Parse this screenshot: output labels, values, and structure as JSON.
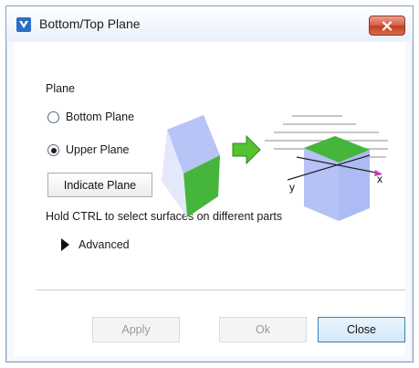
{
  "window": {
    "title": "Bottom/Top Plane"
  },
  "plane": {
    "heading": "Plane",
    "options": [
      {
        "label": "Bottom Plane",
        "selected": false
      },
      {
        "label": "Upper Plane",
        "selected": true
      }
    ],
    "indicate_label": "Indicate Plane",
    "hint": "Hold CTRL to select surfaces on different parts",
    "advanced_label": "Advanced"
  },
  "illustration": {
    "axis_y": "y",
    "axis_x": "x"
  },
  "footer": {
    "apply_label": "Apply",
    "ok_label": "Ok",
    "close_label": "Close"
  },
  "colors": {
    "cube_green": "#3fae3a",
    "cube_blue": "#a9b7f3",
    "arrow_green": "#4fbf2f",
    "close_x_red": "#c33e23"
  }
}
